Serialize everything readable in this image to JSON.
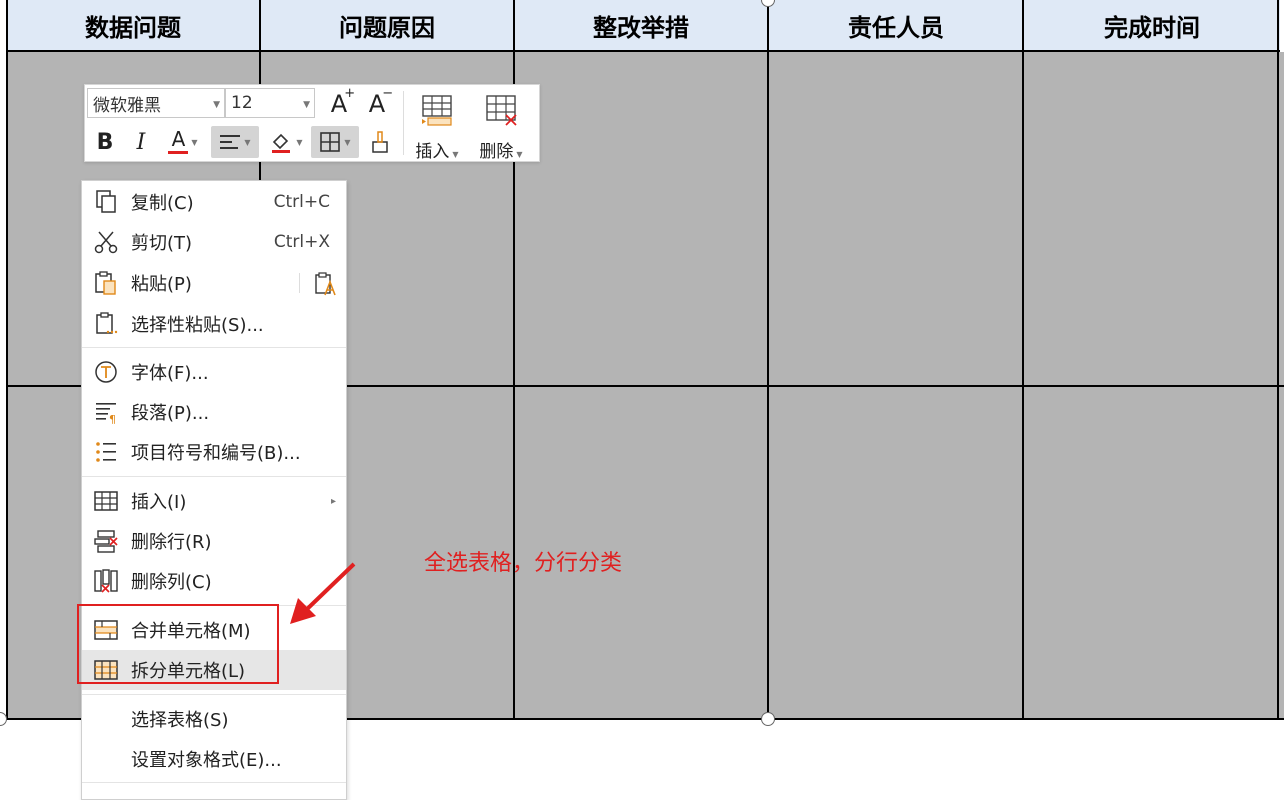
{
  "table": {
    "headers": [
      "数据问题",
      "问题原因",
      "整改举措",
      "责任人员",
      "完成时间"
    ]
  },
  "mini_toolbar": {
    "font_name": "微软雅黑",
    "font_size": "12",
    "grow_font": "A",
    "shrink_font": "A",
    "bold": "B",
    "italic": "I",
    "font_color": "A",
    "insert_label": "插入",
    "delete_label": "删除"
  },
  "context_menu": {
    "items": [
      {
        "label": "复制(C)",
        "shortcut": "Ctrl+C"
      },
      {
        "label": "剪切(T)",
        "shortcut": "Ctrl+X"
      },
      {
        "label": "粘贴(P)",
        "shortcut": ""
      },
      {
        "label": "选择性粘贴(S)...",
        "shortcut": ""
      },
      {
        "label": "字体(F)...",
        "shortcut": ""
      },
      {
        "label": "段落(P)...",
        "shortcut": ""
      },
      {
        "label": "项目符号和编号(B)...",
        "shortcut": ""
      },
      {
        "label": "插入(I)",
        "shortcut": ""
      },
      {
        "label": "删除行(R)",
        "shortcut": ""
      },
      {
        "label": "删除列(C)",
        "shortcut": ""
      },
      {
        "label": "合并单元格(M)",
        "shortcut": ""
      },
      {
        "label": "拆分单元格(L)",
        "shortcut": ""
      },
      {
        "label": "选择表格(S)",
        "shortcut": ""
      },
      {
        "label": "设置对象格式(E)...",
        "shortcut": ""
      }
    ]
  },
  "annotation": {
    "note": "全选表格，分行分类"
  },
  "colors": {
    "header_bg": "#dfe9f6",
    "cell_bg": "#b4b4b4",
    "accent_red": "#e02020",
    "icon_orange": "#e0891a"
  }
}
